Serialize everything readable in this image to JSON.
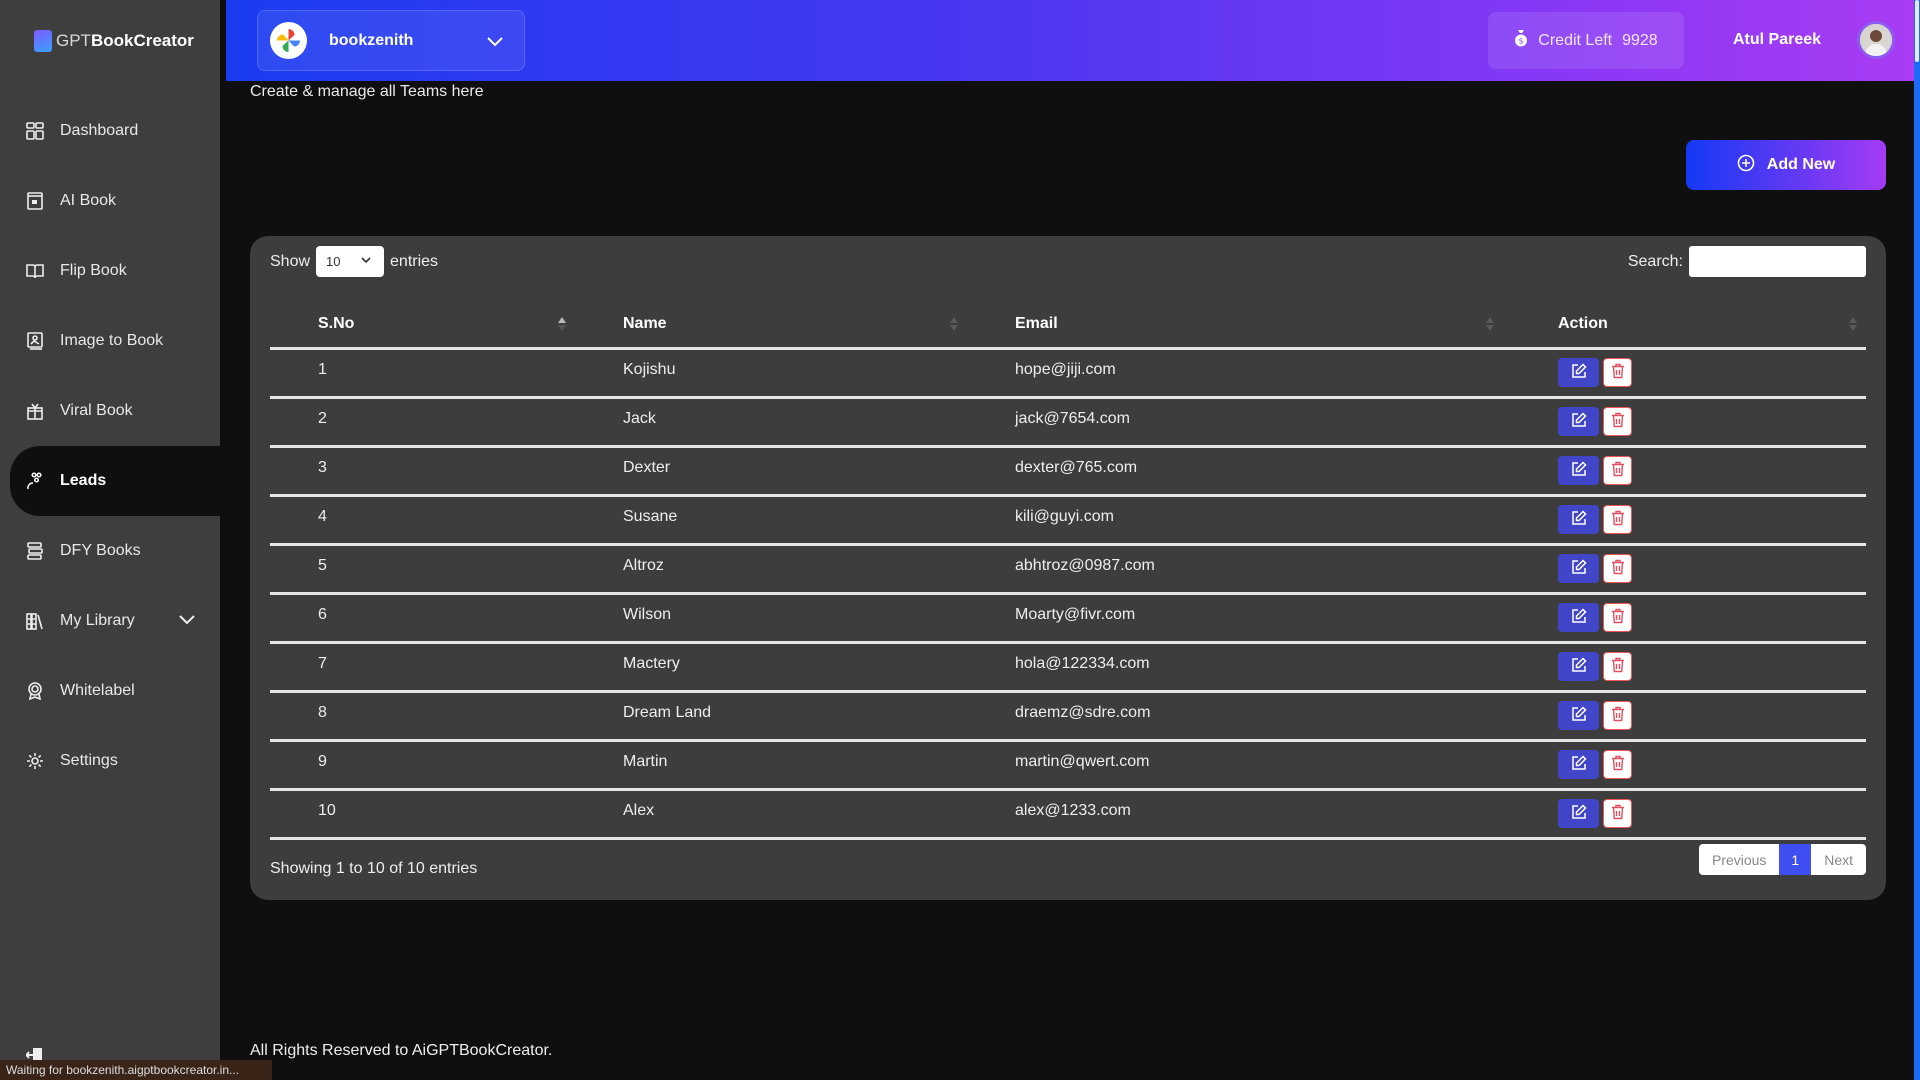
{
  "app": {
    "logo_prefix": "GPT",
    "logo_bold": "BookCreator"
  },
  "sidebar": {
    "items": [
      {
        "label": "Dashboard",
        "icon": "dashboard-icon"
      },
      {
        "label": "AI Book",
        "icon": "ai-book-icon"
      },
      {
        "label": "Flip Book",
        "icon": "open-book-icon"
      },
      {
        "label": "Image to Book",
        "icon": "image-book-icon"
      },
      {
        "label": "Viral Book",
        "icon": "gift-book-icon"
      },
      {
        "label": "Leads",
        "icon": "leads-icon",
        "active": true
      },
      {
        "label": "DFY Books",
        "icon": "books-stack-icon"
      },
      {
        "label": "My Library",
        "icon": "library-icon",
        "expandable": true
      },
      {
        "label": "Whitelabel",
        "icon": "badge-icon"
      },
      {
        "label": "Settings",
        "icon": "gear-icon"
      }
    ],
    "logout_icon": "logout-icon"
  },
  "header": {
    "team_name": "bookzenith",
    "credit_label": "Credit Left",
    "credit_value": "9928",
    "user_name": "Atul Pareek"
  },
  "page": {
    "subtitle": "Create & manage all Teams here",
    "add_button": "Add New"
  },
  "table": {
    "show_label": "Show",
    "entries_label": "entries",
    "page_size": "10",
    "search_label": "Search:",
    "search_value": "",
    "columns": [
      "S.No",
      "Name",
      "Email",
      "Action"
    ],
    "rows": [
      {
        "sno": "1",
        "name": "Kojishu",
        "email": "hope@jiji.com"
      },
      {
        "sno": "2",
        "name": "Jack",
        "email": "jack@7654.com"
      },
      {
        "sno": "3",
        "name": "Dexter",
        "email": "dexter@765.com"
      },
      {
        "sno": "4",
        "name": "Susane",
        "email": "kili@guyi.com"
      },
      {
        "sno": "5",
        "name": "Altroz",
        "email": "abhtroz@0987.com"
      },
      {
        "sno": "6",
        "name": "Wilson",
        "email": "Moarty@fivr.com"
      },
      {
        "sno": "7",
        "name": "Mactery",
        "email": "hola@122334.com"
      },
      {
        "sno": "8",
        "name": "Dream Land",
        "email": "draemz@sdre.com"
      },
      {
        "sno": "9",
        "name": "Martin",
        "email": "martin@qwert.com"
      },
      {
        "sno": "10",
        "name": "Alex",
        "email": "alex@1233.com"
      }
    ],
    "info": "Showing 1 to 10 of 10 entries",
    "pager": {
      "previous": "Previous",
      "current": "1",
      "next": "Next"
    }
  },
  "footer": {
    "text": "All Rights Reserved to AiGPTBookCreator."
  },
  "browser_status": "Waiting for bookzenith.aigptbookcreator.in...",
  "colors": {
    "accent_blue": "#1b3cf0",
    "accent_purple": "#aa3cf4",
    "edit": "#4145c8",
    "pager_active": "#3f4ef0"
  }
}
